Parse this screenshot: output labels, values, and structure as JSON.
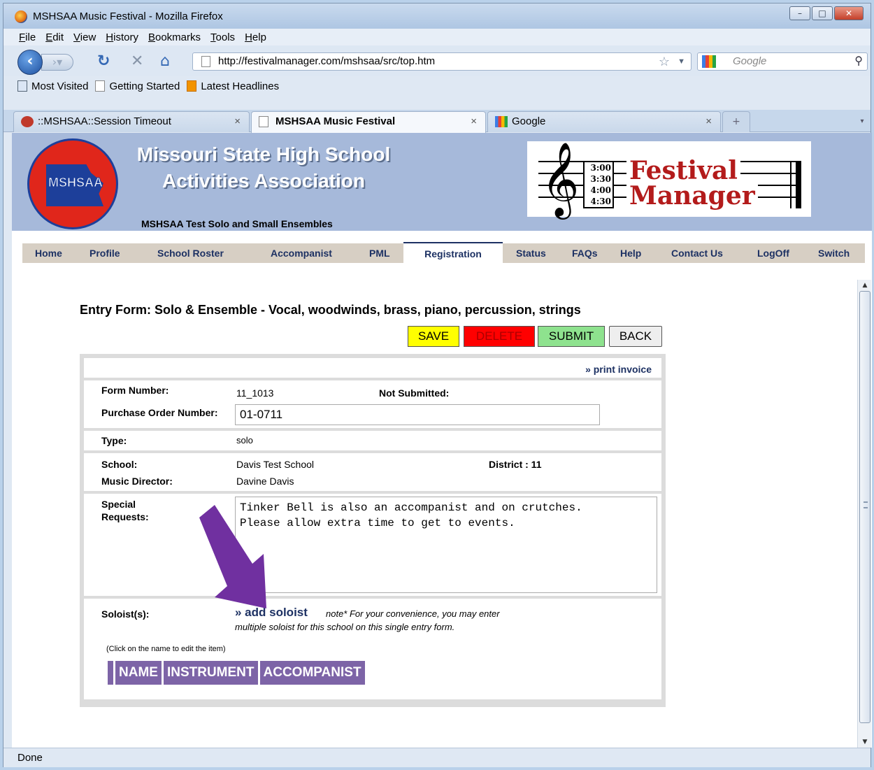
{
  "window": {
    "title": "MSHSAA Music Festival - Mozilla Firefox",
    "minimize_glyph": "–",
    "maximize_glyph": "□",
    "close_glyph": "✕"
  },
  "menu": [
    "File",
    "Edit",
    "View",
    "History",
    "Bookmarks",
    "Tools",
    "Help"
  ],
  "toolbar": {
    "url": "http://festivalmanager.com/mshsaa/src/top.htm",
    "search_placeholder": "Google",
    "back_glyph": "‹",
    "forward_glyph": "›▾",
    "reload_glyph": "↻",
    "stop_glyph": "✕",
    "home_glyph": "⌂",
    "star_glyph": "☆",
    "dropdown_glyph": "▼",
    "search_glyph": "⚲"
  },
  "bookmarks": [
    "Most Visited",
    "Getting Started",
    "Latest Headlines"
  ],
  "tabs": [
    {
      "label": "::MSHSAA::Session Timeout",
      "active": false
    },
    {
      "label": "MSHSAA Music Festival",
      "active": true
    },
    {
      "label": "Google",
      "active": false
    }
  ],
  "tab_close_glyph": "×",
  "tab_new_glyph": "+",
  "tab_list_glyph": "▾",
  "header": {
    "org_line1": "Missouri State High School",
    "org_line2": "Activities Association",
    "logo_text": "MSHSAA",
    "festival_name": "MSHSAA Test Solo and Small Ensembles",
    "fm_clef": "𝄞",
    "fm_times": [
      "3:00",
      "3:30",
      "4:00",
      "4:30"
    ],
    "fm_word1": "Festival",
    "fm_word2": "Manager"
  },
  "site_nav": [
    {
      "label": "Home",
      "active": false
    },
    {
      "label": "Profile",
      "active": false
    },
    {
      "label": "School Roster",
      "active": false
    },
    {
      "label": "Accompanist",
      "active": false
    },
    {
      "label": "PML",
      "active": false
    },
    {
      "label": "Registration",
      "active": true
    },
    {
      "label": "Status",
      "active": false
    },
    {
      "label": "FAQs",
      "active": false
    },
    {
      "label": "Help",
      "active": false
    },
    {
      "label": "Contact Us",
      "active": false
    },
    {
      "label": "LogOff",
      "active": false
    },
    {
      "label": "Switch",
      "active": false
    }
  ],
  "form": {
    "title": "Entry Form: Solo & Ensemble - Vocal, woodwinds, brass, piano, percussion, strings",
    "buttons": {
      "save": "SAVE",
      "delete": "DELETE",
      "submit": "SUBMIT",
      "back": "BACK"
    },
    "print_invoice": "» print invoice",
    "form_number_label": "Form Number:",
    "form_number": "11_1013",
    "status_label": "Not Submitted:",
    "po_label": "Purchase Order Number:",
    "po_value": "01-0711",
    "type_label": "Type:",
    "type_value": "solo",
    "school_label": "School:",
    "school_value": "Davis Test School",
    "district_label": "District : 11",
    "director_label": "Music Director:",
    "director_value": "Davine Davis",
    "special_label_1": "Special",
    "special_label_2": "Requests:",
    "special_text": "Tinker Bell is also an accompanist and on crutches.\nPlease allow extra time to get to events.",
    "soloists_label": "Soloist(s):",
    "add_soloist": "» add soloist",
    "note_1": "note* For your convenience, you may enter",
    "note_2": "multiple soloist for this school on this single entry form.",
    "click_hint": "(Click on the name to edit the item)",
    "columns": [
      "NAME",
      "INSTRUMENT",
      "ACCOMPANIST"
    ]
  },
  "scrollbar": {
    "up_glyph": "▲",
    "down_glyph": "▼"
  },
  "status": "Done",
  "colors": {
    "arrow": "#7030a0",
    "table_header": "#7d64a7",
    "link": "#1d3163"
  }
}
